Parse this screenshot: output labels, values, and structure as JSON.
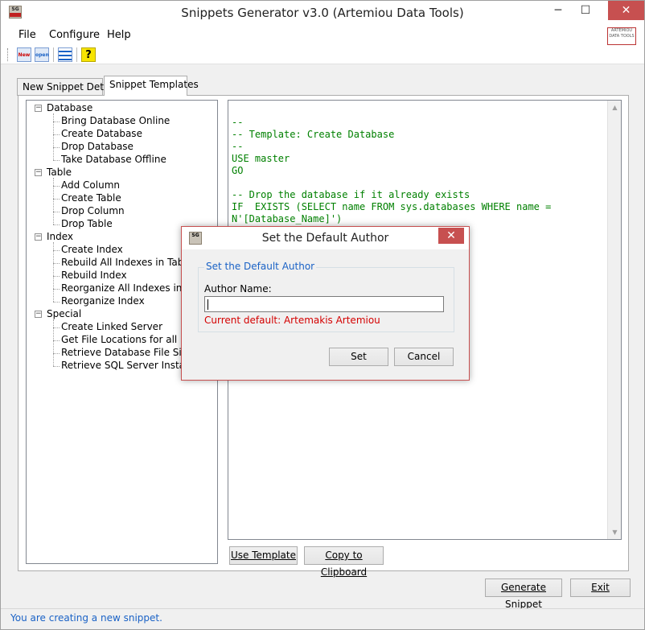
{
  "window": {
    "title": "Snippets Generator v3.0 (Artemiou Data Tools)",
    "minimize": "─",
    "maximize": "☐",
    "close": "✕"
  },
  "menu": {
    "file": "File",
    "configure": "Configure",
    "help": "Help"
  },
  "toolbar": {
    "new_label": "New",
    "open_label": "open",
    "help_label": "?"
  },
  "tabs": {
    "details": "New Snippet Details",
    "templates": "Snippet Templates"
  },
  "tree": [
    {
      "label": "Database",
      "children": [
        "Bring Database Online",
        "Create Database",
        "Drop Database",
        "Take Database Offline"
      ]
    },
    {
      "label": "Table",
      "children": [
        "Add Column",
        "Create Table",
        "Drop Column",
        "Drop Table"
      ]
    },
    {
      "label": "Index",
      "children": [
        "Create Index",
        "Rebuild All Indexes in Table",
        "Rebuild Index",
        "Reorganize All Indexes in Table",
        "Reorganize Index"
      ]
    },
    {
      "label": "Special",
      "children": [
        "Create Linked Server",
        "Get File Locations for all DBs",
        "Retrieve Database File Sizes",
        "Retrieve SQL Server Instance Info"
      ]
    }
  ],
  "editor": {
    "lines": [
      "--",
      "-- Template: Create Database",
      "--",
      "USE master",
      "GO",
      "",
      "-- Drop the database if it already exists",
      "IF  EXISTS (SELECT name FROM sys.databases WHERE name =",
      "N'[Database_Name]')"
    ]
  },
  "buttons": {
    "use_template": "Use Template",
    "copy_clipboard": "Copy to Clipboard",
    "generate": "Generate Snippet",
    "exit": "Exit"
  },
  "status": "You are creating a new snippet.",
  "dialog": {
    "title": "Set the Default Author",
    "group_title": "Set the Default Author",
    "author_label": "Author Name:",
    "author_value": "",
    "current_default": "Current default: Artemakis Artemiou",
    "set": "Set",
    "cancel": "Cancel",
    "close": "✕"
  },
  "colors": {
    "status_blue": "#1a62c6",
    "close_red": "#c75050",
    "code_green": "#008000",
    "warning_red": "#d40000"
  }
}
